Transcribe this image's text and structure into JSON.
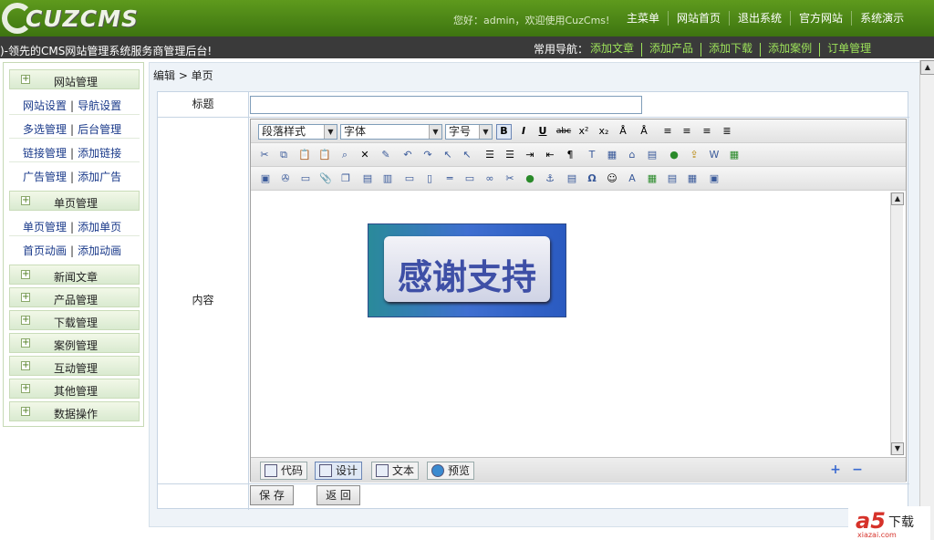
{
  "header": {
    "logo_text": "CUZCMS",
    "greeting": "您好：admin，欢迎使用CuzCms!",
    "menu": [
      "主菜单",
      "网站首页",
      "退出系统",
      "官方网站",
      "系统演示"
    ]
  },
  "subheader": {
    "slogan": ")-领先的CMS网站管理系统服务商管理后台!",
    "quick_nav_label": "常用导航：",
    "quick_nav": [
      "添加文章",
      "添加产品",
      "添加下载",
      "添加案例",
      "订单管理"
    ]
  },
  "sidebar": {
    "sections": [
      {
        "label": "网站管理",
        "links": [
          [
            "网站设置",
            "导航设置"
          ],
          [
            "多选管理",
            "后台管理"
          ],
          [
            "链接管理",
            "添加链接"
          ],
          [
            "广告管理",
            "添加广告"
          ]
        ]
      },
      {
        "label": "单页管理",
        "links": [
          [
            "单页管理",
            "添加单页"
          ],
          [
            "首页动画",
            "添加动画"
          ]
        ]
      },
      {
        "label": "新闻文章",
        "links": []
      },
      {
        "label": "产品管理",
        "links": []
      },
      {
        "label": "下载管理",
        "links": []
      },
      {
        "label": "案例管理",
        "links": []
      },
      {
        "label": "互动管理",
        "links": []
      },
      {
        "label": "其他管理",
        "links": []
      },
      {
        "label": "数据操作",
        "links": []
      }
    ],
    "plus": "+"
  },
  "main": {
    "breadcrumb": "编辑 > 单页",
    "title_label": "标题",
    "title_value": "",
    "content_label": "内容",
    "editor": {
      "paragraph_style": "段落样式",
      "font": "字体",
      "font_size": "字号",
      "bold": "B",
      "italic": "I",
      "underline": "U",
      "strike": "abc",
      "banner_text": "感谢支持",
      "modes": [
        "代码",
        "设计",
        "文本",
        "预览"
      ],
      "active_mode": "设计"
    },
    "save_button": "保 存",
    "back_button": "返 回"
  },
  "watermark": {
    "brand": "a5",
    "text": "下载",
    "url": "xiazai.com"
  }
}
